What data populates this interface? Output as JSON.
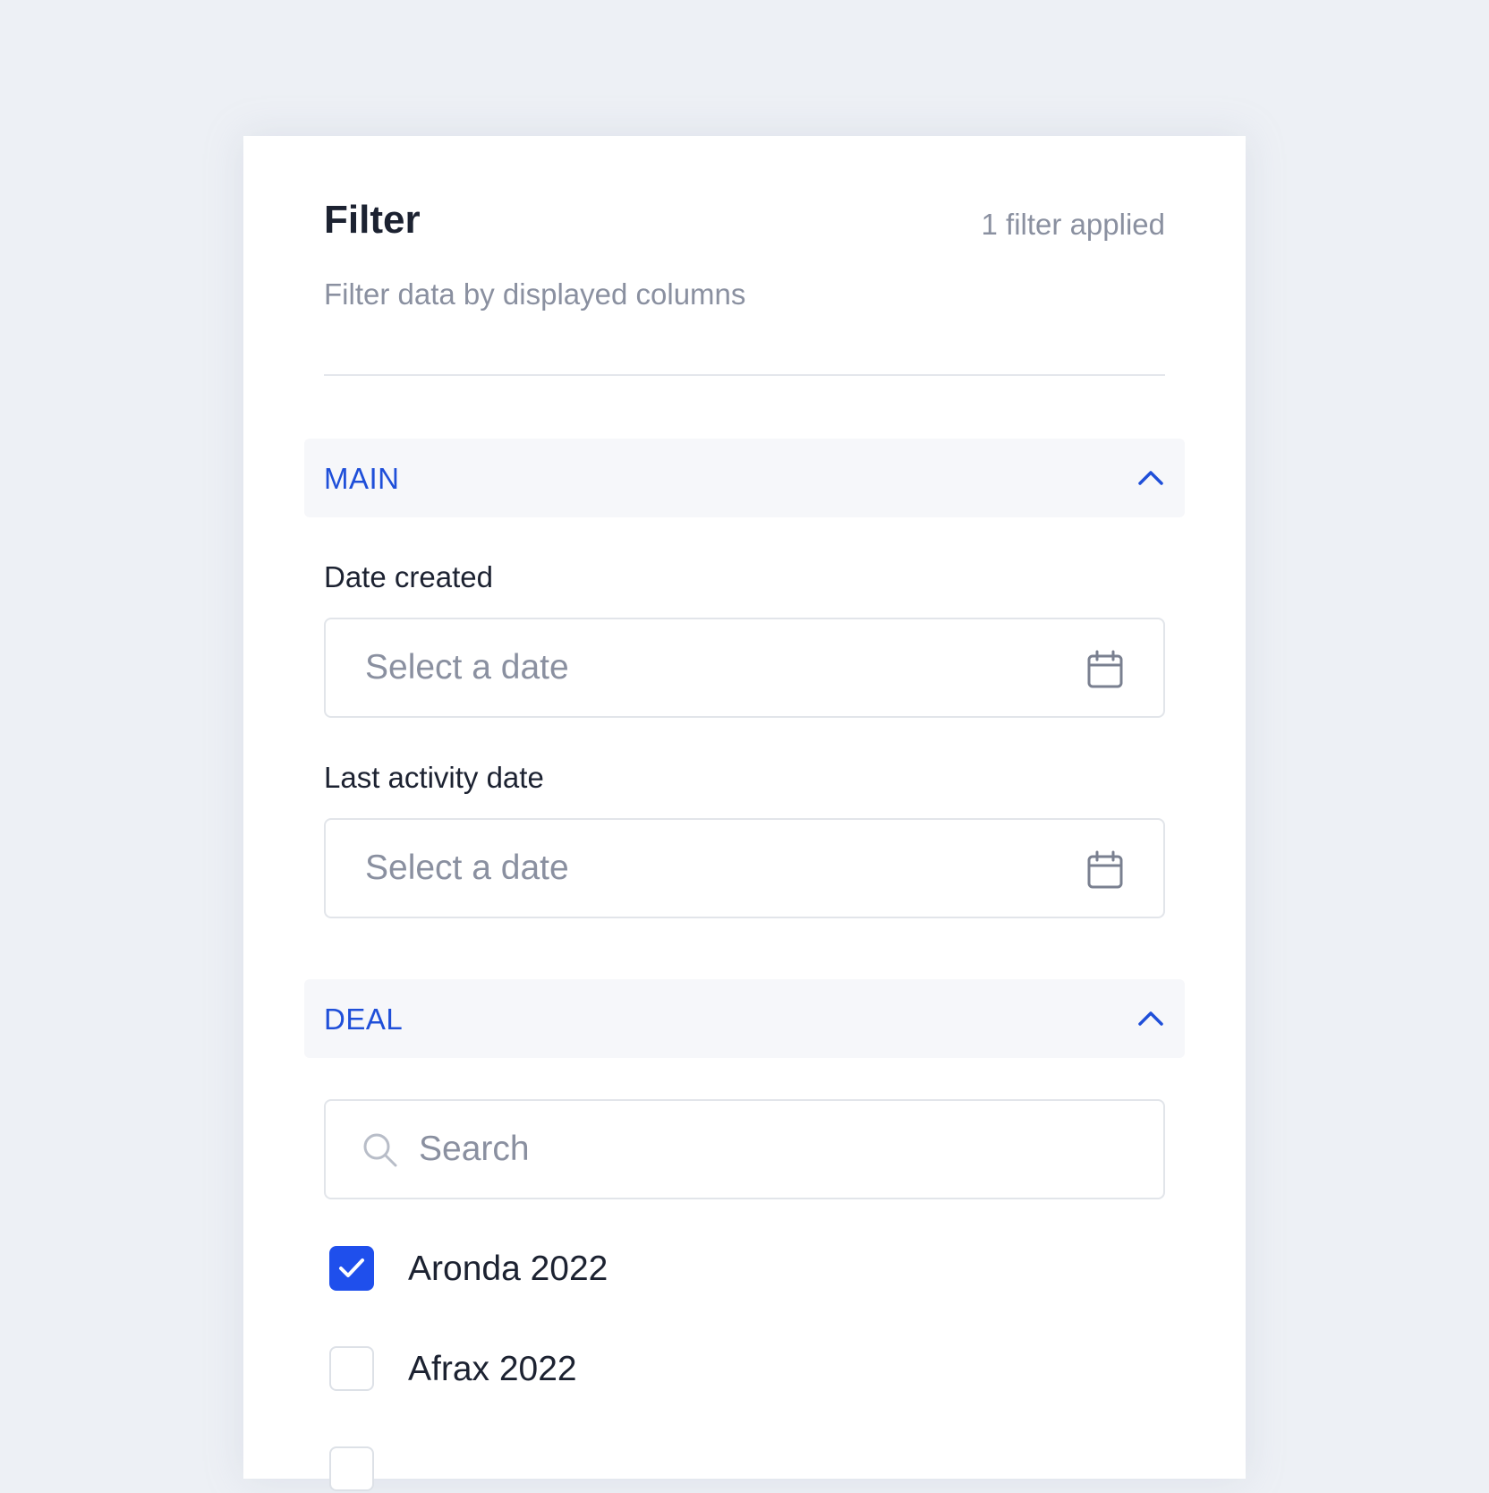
{
  "filter_panel": {
    "title": "Filter",
    "applied_count_text": "1 filter applied",
    "subtitle": "Filter data by displayed columns"
  },
  "sections": {
    "main": {
      "label": "MAIN",
      "expanded": true,
      "fields": [
        {
          "label": "Date created",
          "placeholder": "Select a date",
          "icon": "calendar-icon"
        },
        {
          "label": "Last activity date",
          "placeholder": "Select a date",
          "icon": "calendar-icon"
        }
      ]
    },
    "deal": {
      "label": "DEAL",
      "expanded": true,
      "search_placeholder": "Search",
      "options": [
        {
          "label": "Aronda 2022",
          "checked": true
        },
        {
          "label": "Afrax 2022",
          "checked": false
        }
      ]
    }
  },
  "colors": {
    "accent": "#1f4fec",
    "section_label": "#1f4fd9",
    "muted_text": "#8a90a0",
    "background": "#edf0f5"
  }
}
